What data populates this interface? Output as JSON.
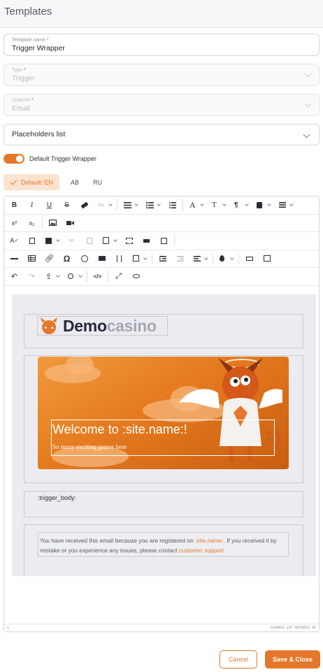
{
  "page": {
    "title": "Templates"
  },
  "form": {
    "template_name": {
      "label": "Template name",
      "required_mark": "*",
      "value": "Trigger Wrapper"
    },
    "type": {
      "label": "Type",
      "required_mark": "*",
      "value": "Trigger"
    },
    "channel": {
      "label": "Channel",
      "required_mark": "*",
      "value": "Email"
    },
    "placeholders": {
      "value": "Placeholders list"
    },
    "default_toggle": {
      "label": "Default Trigger Wrapper",
      "checked": true
    }
  },
  "lang_tabs": [
    {
      "label": "Default: EN",
      "active": true
    },
    {
      "label": "AB",
      "active": false
    },
    {
      "label": "RU",
      "active": false
    }
  ],
  "toolbar": {
    "row1": [
      "B",
      "I",
      "U",
      "S",
      "eraser",
      "Aa",
      "bullets",
      "numbering",
      "list",
      "A",
      "T",
      "¶",
      "paste",
      "align"
    ],
    "row2": [
      "x²",
      "x₂"
    ],
    "row3": [
      "spell",
      "source",
      "save",
      "cut",
      "copy",
      "paste",
      "select",
      "format",
      "preview"
    ],
    "row4_omega": "Ω",
    "row6_code": "</>"
  },
  "email": {
    "logo": {
      "demo": "Demo",
      "casino": "casino"
    },
    "banner": {
      "title": "Welcome to :site.name:!",
      "subtitle": "So many exciting games here"
    },
    "trigger_body": ":trigger_body:",
    "footer": {
      "text1": "You have received this email because you are registered on ",
      "site_link": ":site.name:",
      "text2": ". If you received it by mistake or you experience any issues, please contact ",
      "support_link": "customer support",
      "text3": "."
    }
  },
  "status": {
    "path": "¤",
    "chars": "CHARS: 197",
    "words": "WORDS: 35"
  },
  "actions": {
    "cancel": "Cancel",
    "save": "Save & Close"
  },
  "colors": {
    "accent": "#e5772b",
    "banner_start": "#f09a3c",
    "banner_end": "#c95e10"
  }
}
